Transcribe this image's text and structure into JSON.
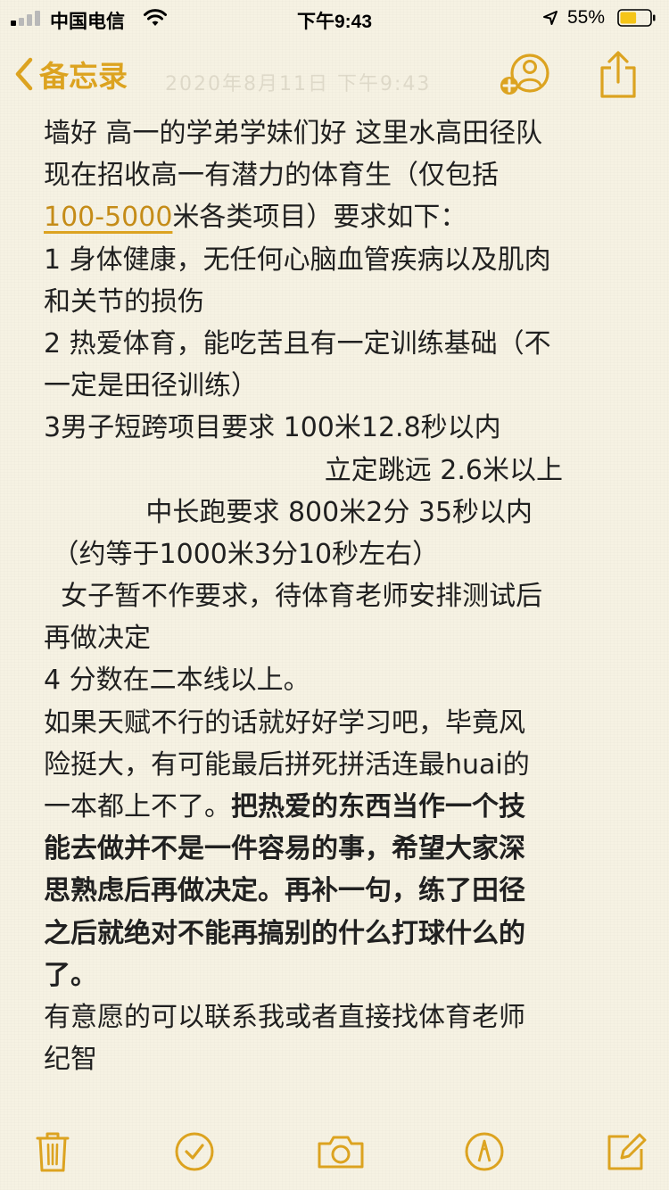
{
  "status_bar": {
    "carrier": "中国电信",
    "time": "下午9:43",
    "battery_percent": "55%",
    "battery_level": 0.55,
    "signal_bars_active": 1,
    "signal_bars_total": 4
  },
  "nav": {
    "back_label": "备忘录",
    "ghost_date": "2020年8月11日 下午9:43"
  },
  "colors": {
    "accent": "#dca320",
    "background": "#f6f2e3",
    "text": "#202020"
  },
  "note": {
    "lines": [
      {
        "text": "墙好 高一的学弟学妹们好 这里水高田径队",
        "bold": false
      },
      {
        "text": "现在招收高一有潜力的体育生（仅包括",
        "bold": false
      },
      {
        "link": "100-5000",
        "text": "米各类项目）要求如下：",
        "bold": false
      },
      {
        "text": "1 身体健康，无任何心脑血管疾病以及肌肉",
        "bold": false
      },
      {
        "text": "和关节的损伤",
        "bold": false
      },
      {
        "text": "2 热爱体育，能吃苦且有一定训练基础（不",
        "bold": false
      },
      {
        "text": "一定是田径训练）",
        "bold": false
      },
      {
        "text": "3男子短跨项目要求 100米12.8秒以内",
        "bold": false
      },
      {
        "text": "                                 立定跳远 2.6米以上",
        "bold": false
      },
      {
        "text": "            中长跑要求 800米2分 35秒以内",
        "bold": false
      },
      {
        "text": " （约等于1000米3分10秒左右）",
        "bold": false
      },
      {
        "text": "  女子暂不作要求，待体育老师安排测试后",
        "bold": false
      },
      {
        "text": "再做决定",
        "bold": false
      },
      {
        "text": "4 分数在二本线以上。",
        "bold": false
      },
      {
        "text": "如果天赋不行的话就好好学习吧，毕竟风",
        "bold": false
      },
      {
        "text": "险挺大，有可能最后拼死拼活连最huai的",
        "bold": false
      },
      {
        "text": "一本都上不了。",
        "bold": false,
        "bold_tail": "把热爱的东西当作一个技"
      },
      {
        "text": "能去做并不是一件容易的事，希望大家深",
        "bold": true
      },
      {
        "text": "思熟虑后再做决定。再补一句，练了田径",
        "bold": true
      },
      {
        "text": "之后就绝对不能再搞别的什么打球什么的",
        "bold": true
      },
      {
        "text": "了。",
        "bold": true
      },
      {
        "text": "有意愿的可以联系我或者直接找体育老师",
        "bold": false
      },
      {
        "text": "纪智",
        "bold": false
      }
    ]
  },
  "toolbar": {
    "icons": [
      "trash-icon",
      "checklist-icon",
      "camera-icon",
      "markup-icon",
      "compose-icon"
    ]
  }
}
